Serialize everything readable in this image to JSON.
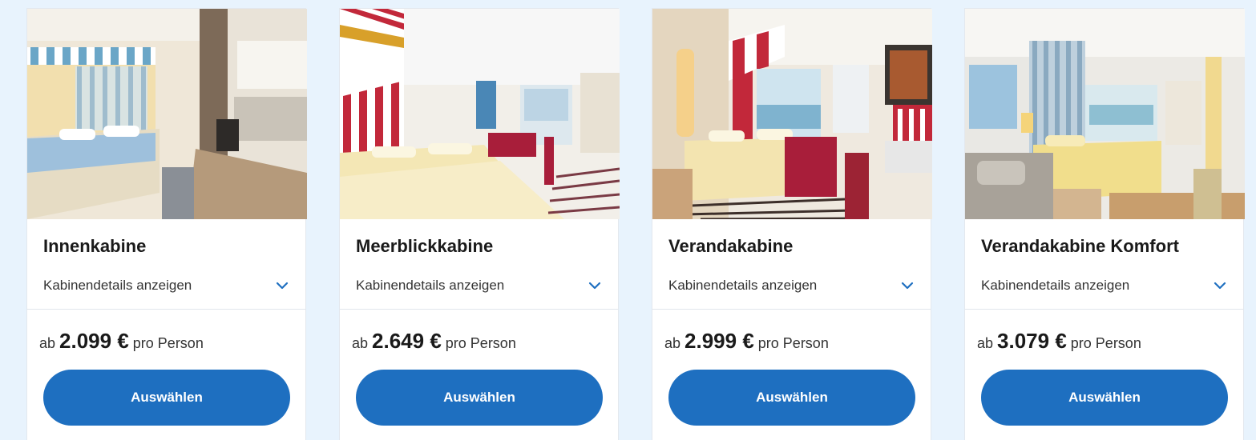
{
  "accent_color": "#1e6fc0",
  "background_color": "#e8f3fd",
  "cabins": [
    {
      "image_icon": "cabin-photo-inner",
      "title": "Innenkabine",
      "details_label": "Kabinendetails anzeigen",
      "price_prefix": "ab",
      "price": "2.099 €",
      "price_suffix": "pro Person",
      "select_label": "Auswählen"
    },
    {
      "image_icon": "cabin-photo-seaview",
      "title": "Meerblickkabine",
      "details_label": "Kabinendetails anzeigen",
      "price_prefix": "ab",
      "price": "2.649 €",
      "price_suffix": "pro Person",
      "select_label": "Auswählen"
    },
    {
      "image_icon": "cabin-photo-veranda",
      "title": "Verandakabine",
      "details_label": "Kabinendetails anzeigen",
      "price_prefix": "ab",
      "price": "2.999 €",
      "price_suffix": "pro Person",
      "select_label": "Auswählen"
    },
    {
      "image_icon": "cabin-photo-veranda-comfort",
      "title": "Verandakabine Komfort",
      "details_label": "Kabinendetails anzeigen",
      "price_prefix": "ab",
      "price": "3.079 €",
      "price_suffix": "pro Person",
      "select_label": "Auswählen"
    }
  ]
}
